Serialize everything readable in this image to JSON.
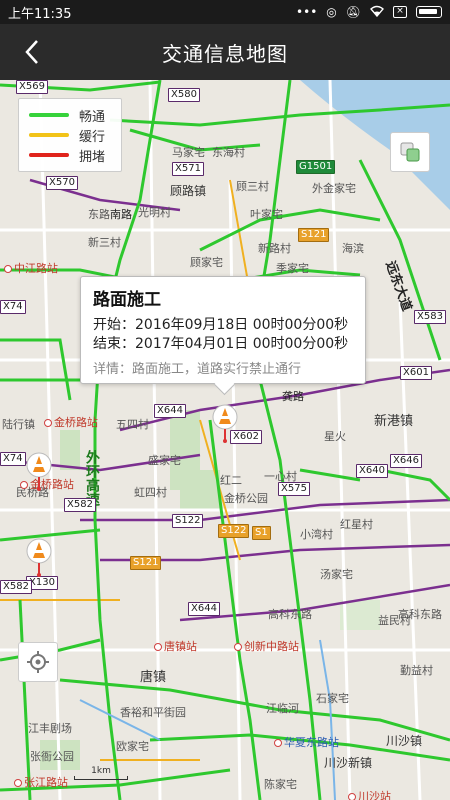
{
  "status": {
    "time": "上午11:35",
    "dots": "•••"
  },
  "header": {
    "title": "交通信息地图"
  },
  "legend": {
    "items": [
      {
        "label": "畅通",
        "color": "#36d23a"
      },
      {
        "label": "缓行",
        "color": "#f2c318"
      },
      {
        "label": "拥堵",
        "color": "#e0231c"
      }
    ]
  },
  "popup": {
    "title": "路面施工",
    "start": "开始：2016年09月18日 00时00分00秒",
    "end": "结束：2017年04月01日 00时00分00秒",
    "detail": "详情：路面施工，道路实行禁止通行"
  },
  "map": {
    "places": [
      {
        "t": "马家宅"
      },
      {
        "t": "东海村"
      },
      {
        "t": "顾路镇"
      },
      {
        "t": "顾三村"
      },
      {
        "t": "外金家宅"
      },
      {
        "t": "光明村"
      },
      {
        "t": "叶家宅"
      },
      {
        "t": "东路"
      },
      {
        "t": "新三村"
      },
      {
        "t": "新路村"
      },
      {
        "t": "顾家宅"
      },
      {
        "t": "季家宅"
      },
      {
        "t": "海滨"
      },
      {
        "t": "中江路站"
      },
      {
        "t": "金桥路站"
      },
      {
        "t": "五四村"
      },
      {
        "t": "新港镇"
      },
      {
        "t": "星火"
      },
      {
        "t": "盛家宅"
      },
      {
        "t": "虹四村"
      },
      {
        "t": "红二"
      },
      {
        "t": "金桥公园"
      },
      {
        "t": "一心村"
      },
      {
        "t": "小湾村"
      },
      {
        "t": "红星村"
      },
      {
        "t": "汤家宅"
      },
      {
        "t": "高科东路"
      },
      {
        "t": "益民村"
      },
      {
        "t": "唐镇"
      },
      {
        "t": "勤益村"
      },
      {
        "t": "石家宅"
      },
      {
        "t": "江临河"
      },
      {
        "t": "江丰剧场"
      },
      {
        "t": "张衙公园"
      },
      {
        "t": "欧家宅"
      },
      {
        "t": "香裕和平街园"
      },
      {
        "t": "川沙新镇"
      },
      {
        "t": "川沙镇"
      },
      {
        "t": "陆行镇"
      },
      {
        "t": "张江路站"
      },
      {
        "t": "陈家宅"
      },
      {
        "t": "高科东路"
      },
      {
        "t": "民桥路"
      }
    ],
    "roads": [
      {
        "t": "龚路"
      },
      {
        "t": "远东大道"
      },
      {
        "t": "外环高速"
      },
      {
        "t": "南路"
      }
    ],
    "shields": [
      {
        "t": "X569"
      },
      {
        "t": "X580"
      },
      {
        "t": "X571"
      },
      {
        "t": "X570"
      },
      {
        "t": "G1501"
      },
      {
        "t": "S121"
      },
      {
        "t": "X583"
      },
      {
        "t": "X601"
      },
      {
        "t": "X644"
      },
      {
        "t": "X602"
      },
      {
        "t": "X646"
      },
      {
        "t": "X640"
      },
      {
        "t": "X575"
      },
      {
        "t": "S122"
      },
      {
        "t": "S121"
      },
      {
        "t": "S1"
      },
      {
        "t": "X644"
      },
      {
        "t": "X130"
      },
      {
        "t": "S122"
      },
      {
        "t": "X74"
      },
      {
        "t": "X74"
      },
      {
        "t": "X582"
      },
      {
        "t": "X582"
      }
    ],
    "stations": [
      {
        "t": "唐镇站"
      },
      {
        "t": "创新中路站"
      },
      {
        "t": "华夏东路站"
      },
      {
        "t": "金桥路站"
      },
      {
        "t": "川沙站"
      }
    ],
    "scale": "1km"
  }
}
